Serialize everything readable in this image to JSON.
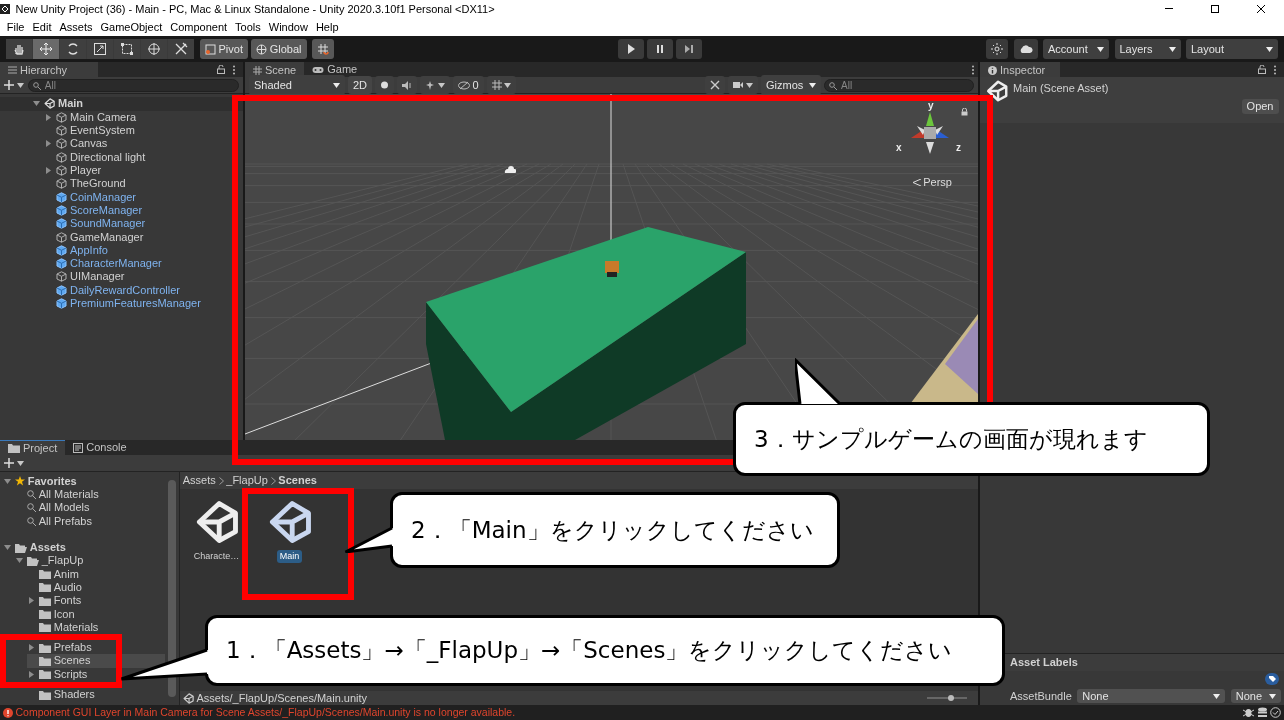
{
  "window": {
    "title": "New Unity Project (36) - Main - PC, Mac & Linux Standalone - Unity 2020.3.10f1 Personal <DX11>"
  },
  "menu": [
    "File",
    "Edit",
    "Assets",
    "GameObject",
    "Component",
    "Tools",
    "Window",
    "Help"
  ],
  "toolbar": {
    "tools": [
      {
        "kind": "hand",
        "selected": false
      },
      {
        "kind": "move",
        "selected": true
      },
      {
        "kind": "rotate",
        "selected": false
      },
      {
        "kind": "scale",
        "selected": false
      },
      {
        "kind": "rect",
        "selected": false
      },
      {
        "kind": "transform",
        "selected": false
      },
      {
        "kind": "custom",
        "selected": false
      }
    ],
    "pivot": "Pivot",
    "global": "Global",
    "account": "Account",
    "layers": "Layers",
    "layout": "Layout"
  },
  "hierarchy": {
    "title": "Hierarchy",
    "search_placeholder": "All",
    "scene": {
      "name": "Main",
      "expanded": true,
      "children": [
        {
          "name": "Main Camera",
          "has_children": true,
          "prefab": false
        },
        {
          "name": "EventSystem",
          "has_children": false,
          "prefab": false
        },
        {
          "name": "Canvas",
          "has_children": true,
          "prefab": false
        },
        {
          "name": "Directional light",
          "has_children": false,
          "prefab": false
        },
        {
          "name": "Player",
          "has_children": true,
          "prefab": false
        },
        {
          "name": "TheGround",
          "has_children": false,
          "prefab": false
        },
        {
          "name": "CoinManager",
          "has_children": false,
          "prefab": true
        },
        {
          "name": "ScoreManager",
          "has_children": false,
          "prefab": true
        },
        {
          "name": "SoundManager",
          "has_children": false,
          "prefab": true
        },
        {
          "name": "GameManager",
          "has_children": false,
          "prefab": false
        },
        {
          "name": "AppInfo",
          "has_children": false,
          "prefab": true
        },
        {
          "name": "CharacterManager",
          "has_children": false,
          "prefab": true
        },
        {
          "name": "UIManager",
          "has_children": false,
          "prefab": false
        },
        {
          "name": "DailyRewardController",
          "has_children": false,
          "prefab": true
        },
        {
          "name": "PremiumFeaturesManager",
          "has_children": false,
          "prefab": true
        }
      ]
    }
  },
  "scene_view": {
    "tabs": [
      {
        "label": "Scene",
        "selected": true
      },
      {
        "label": "Game",
        "selected": false
      }
    ],
    "shading": "Shaded",
    "mode_2d": "2D",
    "hidden_count": "0",
    "gizmos": "Gizmos",
    "search_placeholder": "All",
    "gizmo_axes": [
      "y",
      "x",
      "z"
    ],
    "projection": "Persp"
  },
  "project": {
    "tabs": [
      {
        "label": "Project",
        "selected": true
      },
      {
        "label": "Console",
        "selected": false
      }
    ],
    "favorites": {
      "label": "Favorites",
      "expanded": true,
      "children": [
        {
          "label": "All Materials"
        },
        {
          "label": "All Models"
        },
        {
          "label": "All Prefabs"
        }
      ]
    },
    "assets": {
      "label": "Assets",
      "expanded": true,
      "children": [
        {
          "label": "_FlapUp",
          "has_children": true,
          "expanded": true,
          "selected": false,
          "children": [
            {
              "label": "Anim",
              "has_children": false,
              "expanded": false,
              "selected": false
            },
            {
              "label": "Audio",
              "has_children": false,
              "expanded": false,
              "selected": false
            },
            {
              "label": "Fonts",
              "has_children": true,
              "expanded": false,
              "selected": false
            },
            {
              "label": "Icon",
              "has_children": false,
              "expanded": false,
              "selected": false
            },
            {
              "label": "Materials",
              "has_children": false,
              "expanded": false,
              "selected": false
            },
            {
              "label": "Prefabs",
              "has_children": true,
              "expanded": false,
              "selected": false
            },
            {
              "label": "Scenes",
              "has_children": false,
              "expanded": false,
              "selected": true
            },
            {
              "label": "Scripts",
              "has_children": true,
              "expanded": false,
              "selected": false
            },
            {
              "label": "Shaders",
              "has_children": false,
              "expanded": false,
              "selected": false
            }
          ]
        }
      ]
    },
    "breadcrumb": [
      "Assets",
      "_FlapUp",
      "Scenes"
    ],
    "files": [
      {
        "label": "Characte…",
        "selected": false
      },
      {
        "label": "Main",
        "selected": true
      }
    ],
    "path": "Assets/_FlapUp/Scenes/Main.unity",
    "icon_size": {
      "level": 0.6
    }
  },
  "inspector": {
    "title": "Inspector",
    "asset_title": "Main (Scene Asset)",
    "open_button": "Open",
    "asset_labels": "Asset Labels",
    "asset_bundle": {
      "label": "AssetBundle",
      "name": "None",
      "variant": "None"
    }
  },
  "status_bar": {
    "message": "Component GUI Layer in Main Camera for Scene Assets/_FlapUp/Scenes/Main.unity is no longer available."
  },
  "callouts": [
    {
      "text": "3．サンプルゲームの画面が現れます"
    },
    {
      "text": "2．「Main」をクリックしてください"
    },
    {
      "text": "1．「Assets」→「_FlapUp」→「Scenes」をクリックしてください"
    }
  ]
}
